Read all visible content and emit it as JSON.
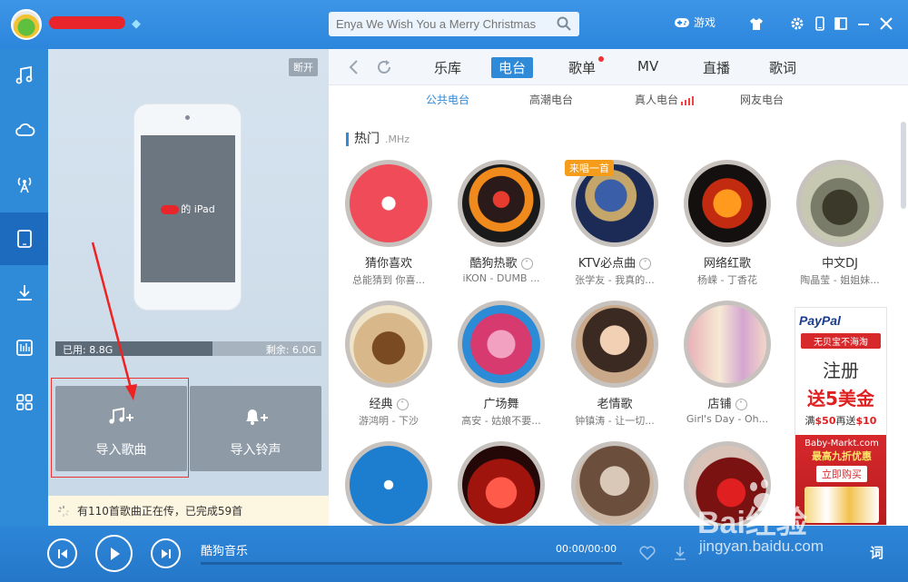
{
  "window": {
    "search_placeholder": "Enya We Wish You a Merry Christmas",
    "game_label": "游戏"
  },
  "device": {
    "disconnect_label": "断开",
    "device_name": "的 iPad",
    "used_label": "已用: 8.8G",
    "free_label": "剩余: 6.0G",
    "used_fraction": 0.59,
    "import_songs_label": "导入歌曲",
    "import_ringtones_label": "导入铃声",
    "transfer_status": "有110首歌曲正在传，已完成59首"
  },
  "topnav": {
    "tabs": [
      "乐库",
      "电台",
      "歌单",
      "MV",
      "直播",
      "歌词"
    ],
    "active_tab": "电台"
  },
  "subnav": {
    "tabs": [
      "公共电台",
      "高潮电台",
      "真人电台",
      "网友电台"
    ],
    "active_tab": "公共电台"
  },
  "section": {
    "title": "热门",
    "unit": ".MHz"
  },
  "stations": [
    {
      "name": "猜你喜欢",
      "sub": "总能猜到 你喜...",
      "chevron": false
    },
    {
      "name": "酷狗热歌",
      "sub": "iKON - DUMB ...",
      "chevron": true
    },
    {
      "name": "KTV必点曲",
      "sub": "张学友 - 我真的...",
      "chevron": true,
      "badge": "来唱一首"
    },
    {
      "name": "网络红歌",
      "sub": "杨嵘 - 丁香花",
      "chevron": false
    },
    {
      "name": "中文DJ",
      "sub": "陶晶莹 - 姐姐妹...",
      "chevron": false
    },
    {
      "name": "经典",
      "sub": "游鸿明 - 下沙",
      "chevron": true
    },
    {
      "name": "广场舞",
      "sub": "高安 - 姑娘不要...",
      "chevron": false
    },
    {
      "name": "老情歌",
      "sub": "钟镇涛 - 让一切...",
      "chevron": false
    },
    {
      "name": "店铺",
      "sub": "Girl's Day - Oh...",
      "chevron": true
    },
    {
      "name": "",
      "sub": "",
      "chevron": false
    },
    {
      "name": "",
      "sub": "",
      "chevron": false
    },
    {
      "name": "",
      "sub": "",
      "chevron": false
    },
    {
      "name": "",
      "sub": "",
      "chevron": false
    }
  ],
  "ad": {
    "brand": "PayPal",
    "banner": "无贝宝不海淘",
    "register": "注册",
    "bonus": "送5美金",
    "rule_prefix": "满",
    "rule_a": "$50",
    "rule_mid": "再送",
    "rule_b": "$10",
    "shop": "Baby-Markt.com",
    "discount": "最高九折优惠",
    "buy": "立即购买"
  },
  "player": {
    "song": "酷狗音乐",
    "time": "00:00/00:00",
    "lyrics_label": "词"
  },
  "watermark": {
    "brand": "Bai经验",
    "url": "jingyan.baidu.com"
  }
}
